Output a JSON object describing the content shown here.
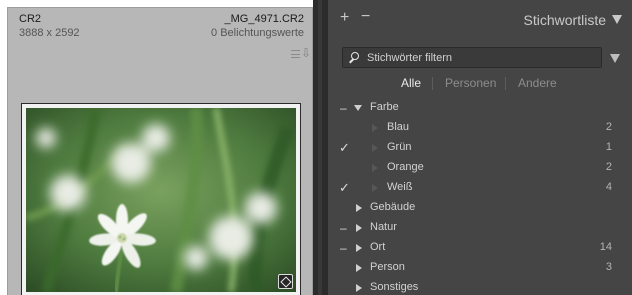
{
  "grid_cell": {
    "file_format": "CR2",
    "dimensions": "3888 x 2592",
    "file_name": "_MG_4971.CR2",
    "exposure_bracket": "0 Belichtungswerte",
    "icons": {
      "stack": "stack-menu-icon",
      "badge": "edit-badge-icon"
    }
  },
  "keyword_panel": {
    "title": "Stichwortliste",
    "add_symbol": "+",
    "remove_symbol": "−",
    "filter_placeholder": "Stichwörter filtern",
    "tabs": [
      {
        "label": "Alle",
        "active": true
      },
      {
        "label": "Personen",
        "active": false
      },
      {
        "label": "Andere",
        "active": false
      }
    ],
    "keywords": [
      {
        "name": "Farbe",
        "level": 0,
        "expanded": true,
        "minus": "–",
        "count": ""
      },
      {
        "name": "Blau",
        "level": 1,
        "count": "2"
      },
      {
        "name": "Grün",
        "level": 1,
        "count": "1",
        "checked": true,
        "check": "✓"
      },
      {
        "name": "Orange",
        "level": 1,
        "count": "2"
      },
      {
        "name": "Weiß",
        "level": 1,
        "count": "4",
        "checked": true,
        "check": "✓"
      },
      {
        "name": "Gebäude",
        "level": 0,
        "count": ""
      },
      {
        "name": "Natur",
        "level": 0,
        "minus": "–",
        "count": ""
      },
      {
        "name": "Ort",
        "level": 0,
        "minus": "–",
        "count": "14"
      },
      {
        "name": "Person",
        "level": 0,
        "count": "3"
      },
      {
        "name": "Sonstiges",
        "level": 0,
        "count": ""
      }
    ]
  },
  "colors": {
    "grid_background": "#b7b7b7",
    "panel_background": "#454545",
    "panel_text": "#d2d2d2",
    "active_tab": "#e9e9e9",
    "inactive_tab": "#8d8d8d"
  }
}
